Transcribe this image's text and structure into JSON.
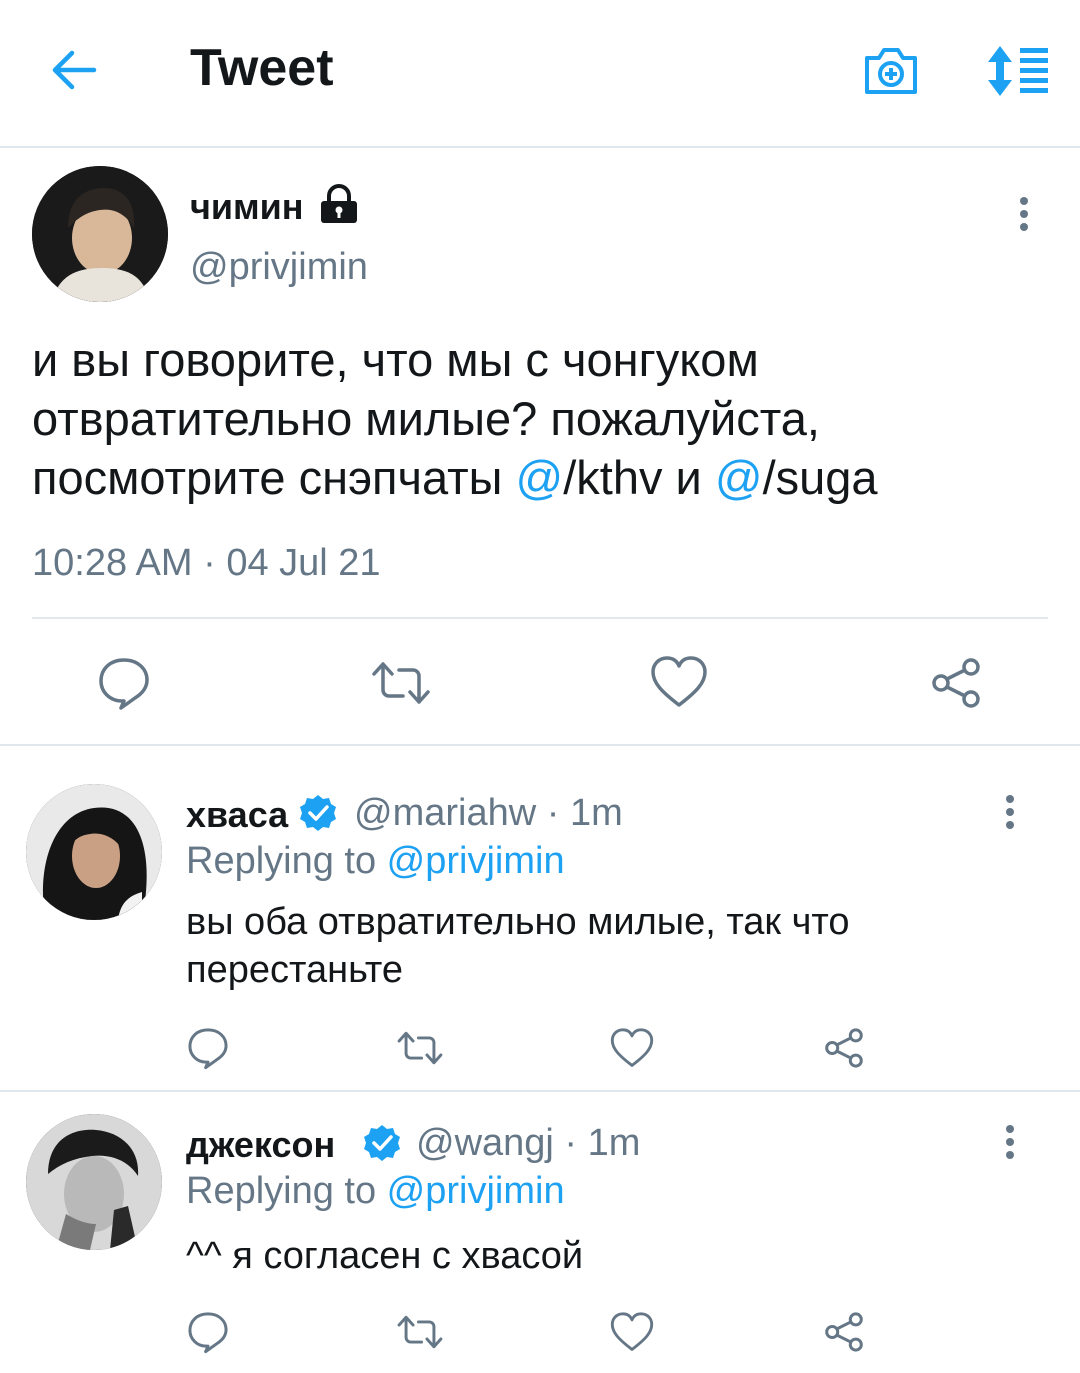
{
  "header": {
    "title": "Tweet",
    "icons": [
      "arrow-left-icon",
      "camera-add-icon",
      "sort-lines-icon"
    ]
  },
  "main_tweet": {
    "name": "чимин",
    "handle": "@privjimin",
    "text_plain": "и вы говорите, что мы с чонгуком отвратительно милые? пожалуйста, посмотрите снэпчаты ",
    "mention1_at": "@",
    "mention1_rest": "/kthv",
    "text_mid": " и ",
    "mention2_at": "@",
    "mention2_rest": "/suga",
    "timestamp": "10:28 AM · 04 Jul 21"
  },
  "replies": [
    {
      "name": "хваса",
      "meta": "@mariahw · 1m",
      "replying_label": "Replying to ",
      "replying_handle": "@privjimin",
      "text": "вы оба отвратительно милые, так что перестаньте"
    },
    {
      "name": "джексон",
      "meta": "@wangj · 1m",
      "replying_label": "Replying to ",
      "replying_handle": "@privjimin",
      "text": "^^ я согласен с хвасой"
    }
  ],
  "colors": {
    "accent": "#1da1f2",
    "text": "#14171a",
    "secondary": "#657786",
    "divider": "#e1e8ed"
  }
}
